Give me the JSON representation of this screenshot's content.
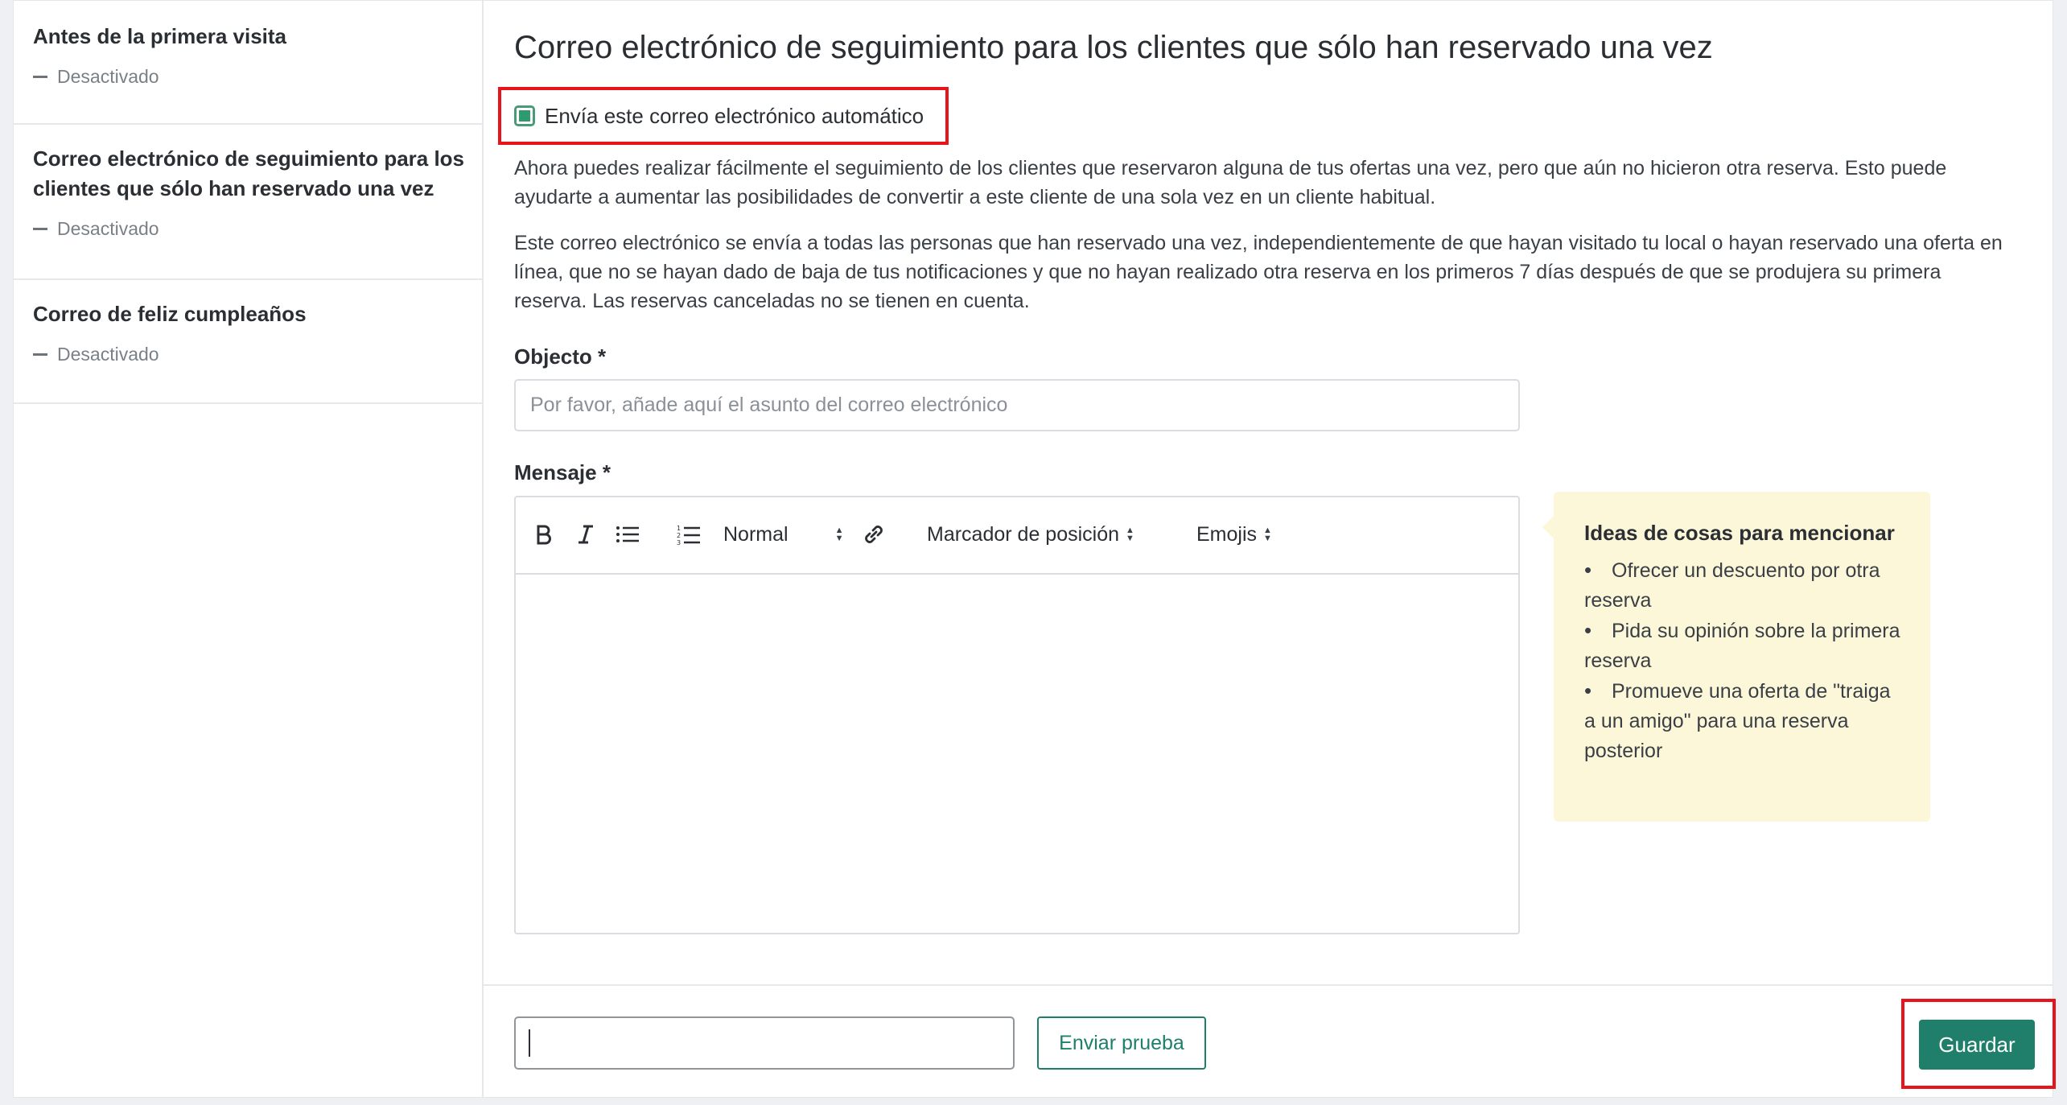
{
  "sidebar": {
    "items": [
      {
        "title": "Antes de la primera visita",
        "status": "Desactivado"
      },
      {
        "title": "Correo electrónico de seguimiento para los clientes que sólo han reservado una vez",
        "status": "Desactivado"
      },
      {
        "title": "Correo de feliz cumpleaños",
        "status": "Desactivado"
      }
    ]
  },
  "main": {
    "title": "Correo electrónico de seguimiento para los clientes que sólo han reservado una vez",
    "enable_label": "Envía este correo electrónico automático",
    "enable_checked": true,
    "paragraph1": "Ahora puedes realizar fácilmente el seguimiento de los clientes que reservaron alguna de tus ofertas una vez, pero que aún no hicieron otra reserva. Esto puede ayudarte a aumentar las posibilidades de convertir a este cliente de una sola vez en un cliente habitual.",
    "paragraph2": "Este correo electrónico se envía a todas las personas que han reservado una vez, independientemente de que hayan visitado tu local o hayan reservado una oferta en línea, que no se hayan dado de baja de tus notificaciones y que no hayan realizado otra reserva en los primeros 7 días después de que se produjera su primera reserva. Las reservas canceladas no se tienen en cuenta.",
    "subject": {
      "label": "Objecto *",
      "placeholder": "Por favor, añade aquí el asunto del correo electrónico",
      "value": ""
    },
    "message": {
      "label": "Mensaje *",
      "toolbar": {
        "format_select": "Normal",
        "placeholder_menu": "Marcador de posición",
        "emojis_menu": "Emojis"
      }
    },
    "tips": {
      "title": "Ideas de cosas para mencionar",
      "items": [
        "Ofrecer un descuento por otra reserva",
        "Pida su opinión sobre la primera reserva",
        "Promueve una oferta de \"traiga a un amigo\" para una reserva posterior"
      ]
    }
  },
  "footer": {
    "test_email_value": "",
    "send_test_label": "Enviar prueba",
    "save_label": "Guardar"
  },
  "colors": {
    "accent": "#1f7f6a",
    "highlight": "#e8141b",
    "tips_bg": "#fcf7d8"
  }
}
